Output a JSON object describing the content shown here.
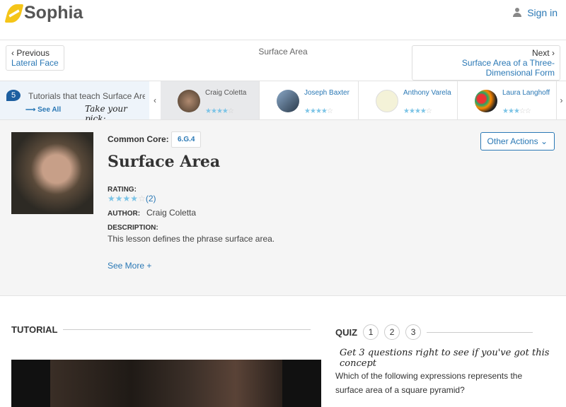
{
  "header": {
    "logo": "Sophia",
    "sign_in": "Sign in"
  },
  "nav": {
    "prev_label": "Previous",
    "prev_title": "Lateral Face",
    "page_title": "Surface Area",
    "next_label": "Next",
    "next_title": "Surface Area of a Three-Dimensional Form"
  },
  "strip": {
    "count": "5",
    "text": "Tutorials that teach Surface Area",
    "see_all": "See All",
    "pick": "Take your pick:",
    "tutors": [
      {
        "name": "Craig Coletta",
        "rating": 3.5
      },
      {
        "name": "Joseph Baxter",
        "rating": 3.5
      },
      {
        "name": "Anthony Varela",
        "rating": 3.5
      },
      {
        "name": "Laura Langhoff",
        "rating": 3
      }
    ]
  },
  "info": {
    "common_core_label": "Common Core:",
    "common_core_code": "6.G.4",
    "title": "Surface Area",
    "rating_label": "RATING:",
    "rating": 4,
    "rating_count": "(2)",
    "author_label": "AUTHOR:",
    "author": "Craig Coletta",
    "description_label": "DESCRIPTION:",
    "description": "This lesson defines the phrase surface area.",
    "see_more": "See More +",
    "other_actions": "Other Actions"
  },
  "tutorial": {
    "heading": "TUTORIAL"
  },
  "quiz": {
    "heading": "QUIZ",
    "numbers": [
      "1",
      "2",
      "3"
    ],
    "prompt": "Get 3 questions right to see if you've got this concept",
    "question": "Which of the following expressions represents the surface area of a square pyramid?"
  },
  "colors": {
    "accent": "#2a78b5",
    "star": "#7cc4e6"
  }
}
